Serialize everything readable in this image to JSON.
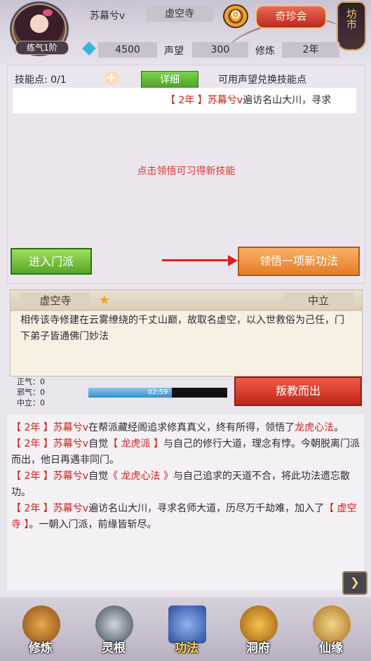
{
  "header": {
    "level_tag": "练气1阶",
    "player_name": "苏幕兮v",
    "sect": "虚空寺",
    "qizhen_button": "奇珍会",
    "market_button": "坊市",
    "spirit_stones": "4500",
    "reputation_label": "声望",
    "reputation_value": "300",
    "cultivation_label": "修炼",
    "cultivation_value": "2年"
  },
  "skill_panel": {
    "skill_points": "技能点: 0/1",
    "detail_button": "详细",
    "exchange_label": "可用声望兑换技能点",
    "ticker": {
      "year": "【 2年 】",
      "name": "苏幕兮v",
      "text": "遍访名山大川，寻求"
    },
    "hint": "点击领悟可习得新技能",
    "join_button": "进入门派",
    "comprehend_button": "领悟一项新功法"
  },
  "sect_card": {
    "name": "虚空寺",
    "alignment": "中立",
    "description": "相传该寺修建在云雾缭绕的千丈山巅，故取名虚空，以入世救俗为己任，门下弟子皆通佛门妙法"
  },
  "alignment_stats": {
    "righteous": "正气：0",
    "evil": "邪气：0",
    "neutral": "中立：0"
  },
  "timer": {
    "text": "02:59",
    "progress": 0.6
  },
  "rebel_button": "叛教而出",
  "log": [
    {
      "year": "【 2年 】",
      "name": "苏幕兮v",
      "text1": "在帮派藏经阁追求修真真义，终有所得，领悟了",
      "highlight": "龙虎心法",
      "text2": "。"
    },
    {
      "year": "【 2年 】",
      "name": "苏幕兮v",
      "text1": "自觉",
      "highlight": "【 龙虎派 】",
      "text2": "与自己的修行大道，理念有悖。今朝脱离门派而出，他日再遇非同门。"
    },
    {
      "year": "【 2年 】",
      "name": "苏幕兮v",
      "text1": "自觉",
      "highlight": "《 龙虎心法 》",
      "text2": "与自己追求的天道不合，将此功法遗忘散功。"
    },
    {
      "year": "【 2年 】",
      "name": "苏幕兮v",
      "text1": "遍访名山大川，寻求名师大道，历尽万千劫难，加入了",
      "highlight": "【 虚空寺 】",
      "text2": "。一朝入门派，前缘皆斩尽。"
    }
  ],
  "bottom_nav": [
    {
      "label": "修炼",
      "icon": "monk-icon",
      "color": "#c77a2a"
    },
    {
      "label": "灵根",
      "icon": "sword-icon",
      "color": "#6a7c8a"
    },
    {
      "label": "功法",
      "icon": "book-icon",
      "color": "#4a6fc4"
    },
    {
      "label": "洞府",
      "icon": "pavilion-icon",
      "color": "#d69a2a"
    },
    {
      "label": "仙缘",
      "icon": "gourd-icon",
      "color": "#d2a54a"
    }
  ],
  "colors": {
    "highlight_red": "#c9221a",
    "join_green": "#56a628",
    "comprehend_orange": "#e47b27",
    "rebel_red": "#c1251d"
  }
}
